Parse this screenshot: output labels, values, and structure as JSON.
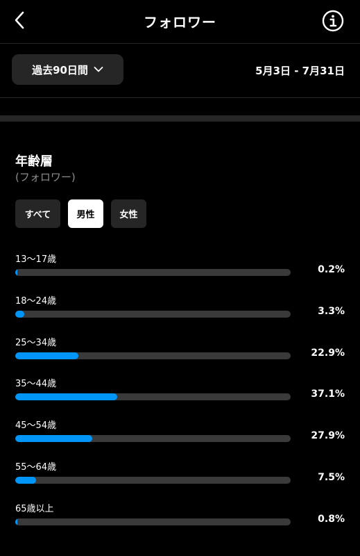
{
  "header": {
    "title": "フォロワー",
    "back_icon": "chevron-left-icon",
    "info_icon": "info-icon"
  },
  "filter": {
    "range_label": "過去90日間",
    "dropdown_icon": "chevron-down-icon",
    "date_range": "5月3日 - 7月31日"
  },
  "section": {
    "title": "年齢層",
    "subtitle": "(フォロワー)",
    "tabs": [
      {
        "label": "すべて",
        "active": false
      },
      {
        "label": "男性",
        "active": true
      },
      {
        "label": "女性",
        "active": false
      }
    ]
  },
  "colors": {
    "accent": "#0095f6",
    "track": "#3a3a3a",
    "chip": "#262626"
  },
  "chart_data": {
    "type": "bar",
    "categories": [
      "13〜17歳",
      "18〜24歳",
      "25〜34歳",
      "35〜44歳",
      "45〜54歳",
      "55〜64歳",
      "65歳以上"
    ],
    "values": [
      0.2,
      3.3,
      22.9,
      37.1,
      27.9,
      7.5,
      0.8
    ],
    "value_labels": [
      "0.2%",
      "3.3%",
      "22.9%",
      "37.1%",
      "27.9%",
      "7.5%",
      "0.8%"
    ],
    "xlim": [
      0,
      100
    ]
  }
}
